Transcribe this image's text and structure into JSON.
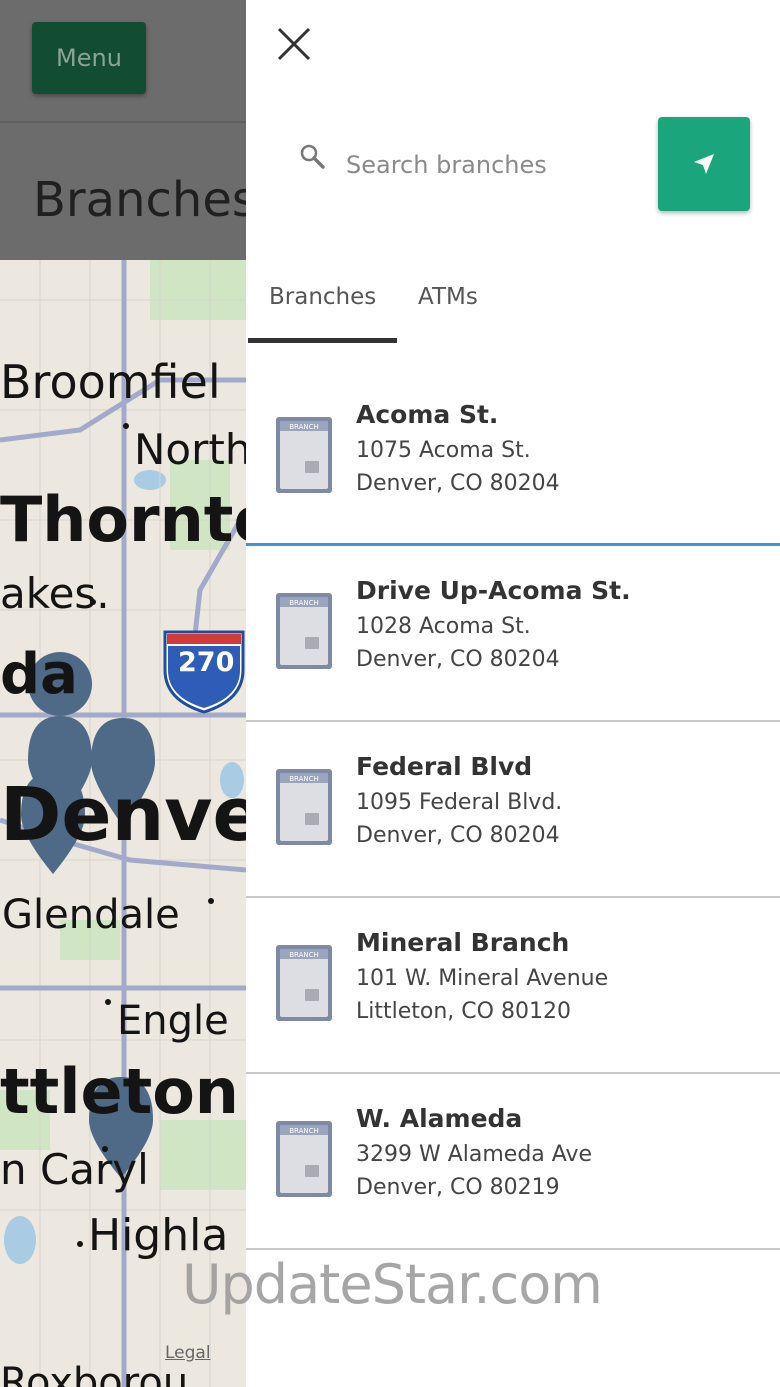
{
  "background_page": {
    "menu_label": "Menu",
    "page_title": "Branches",
    "header_color": "#6c6c6c",
    "menu_color": "#124c32",
    "map": {
      "labels": [
        "Broomfiel",
        "North",
        "Thornto",
        "akes.",
        "da",
        "270",
        "Denver",
        "Glendale",
        "Engle",
        "ttleton",
        "n Caryl",
        "Highla",
        "Roxborou"
      ],
      "legal": "Legal",
      "pin_color": "#4f6a86"
    }
  },
  "drawer": {
    "close_icon": "close-icon",
    "search": {
      "icon": "search-icon",
      "placeholder": "Search branches",
      "value": ""
    },
    "locate_button": {
      "icon": "navigation-arrow-icon",
      "color": "#1ba57d"
    },
    "tabs": [
      {
        "label": "Branches",
        "active": true
      },
      {
        "label": "ATMs",
        "active": false
      }
    ],
    "branches": [
      {
        "name": "Acoma St.",
        "address1": "1075 Acoma St.",
        "address2": "Denver, CO 80204",
        "selected": true
      },
      {
        "name": "Drive Up-Acoma St.",
        "address1": "1028 Acoma St.",
        "address2": "Denver, CO 80204",
        "selected": false
      },
      {
        "name": "Federal Blvd",
        "address1": "1095 Federal Blvd.",
        "address2": "Denver, CO 80204",
        "selected": false
      },
      {
        "name": "Mineral Branch",
        "address1": "101 W. Mineral Avenue",
        "address2": "Littleton, CO 80120",
        "selected": false
      },
      {
        "name": "W. Alameda",
        "address1": "3299 W Alameda Ave",
        "address2": "Denver, CO 80219",
        "selected": false
      }
    ],
    "branch_icon": "branch-building-icon",
    "branch_icon_label": "BRANCH"
  },
  "watermark": "UpdateStar.com"
}
